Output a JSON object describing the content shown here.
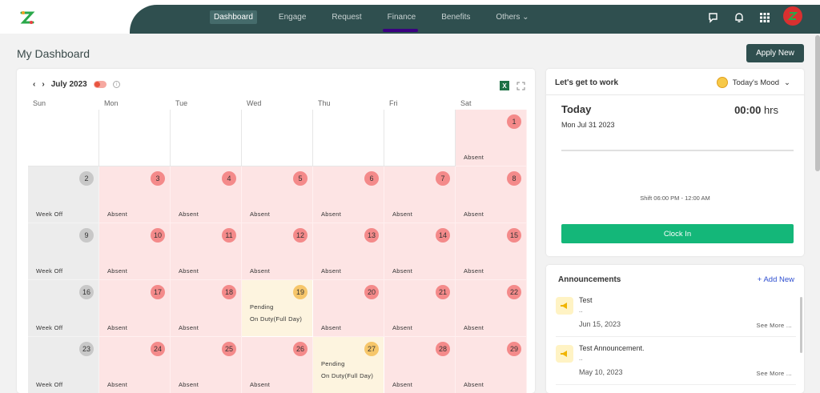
{
  "nav": {
    "items": [
      "Dashboard",
      "Engage",
      "Request",
      "Finance",
      "Benefits",
      "Others"
    ]
  },
  "page": {
    "title": "My Dashboard",
    "apply_label": "Apply New"
  },
  "calendar": {
    "month_label": "July 2023",
    "weekdays": [
      "Sun",
      "Mon",
      "Tue",
      "Wed",
      "Thu",
      "Fri",
      "Sat"
    ],
    "cells": [
      {
        "day": "",
        "kind": "empty",
        "status": ""
      },
      {
        "day": "",
        "kind": "empty",
        "status": ""
      },
      {
        "day": "",
        "kind": "empty",
        "status": ""
      },
      {
        "day": "",
        "kind": "empty",
        "status": ""
      },
      {
        "day": "",
        "kind": "empty",
        "status": ""
      },
      {
        "day": "",
        "kind": "empty",
        "status": ""
      },
      {
        "day": "1",
        "kind": "absent",
        "status": "Absent"
      },
      {
        "day": "2",
        "kind": "weekoff",
        "status": "Week Off"
      },
      {
        "day": "3",
        "kind": "absent",
        "status": "Absent"
      },
      {
        "day": "4",
        "kind": "absent",
        "status": "Absent"
      },
      {
        "day": "5",
        "kind": "absent",
        "status": "Absent"
      },
      {
        "day": "6",
        "kind": "absent",
        "status": "Absent"
      },
      {
        "day": "7",
        "kind": "absent",
        "status": "Absent"
      },
      {
        "day": "8",
        "kind": "absent",
        "status": "Absent"
      },
      {
        "day": "9",
        "kind": "weekoff",
        "status": "Week Off"
      },
      {
        "day": "10",
        "kind": "absent",
        "status": "Absent"
      },
      {
        "day": "11",
        "kind": "absent",
        "status": "Absent"
      },
      {
        "day": "12",
        "kind": "absent",
        "status": "Absent"
      },
      {
        "day": "13",
        "kind": "absent",
        "status": "Absent"
      },
      {
        "day": "14",
        "kind": "absent",
        "status": "Absent"
      },
      {
        "day": "15",
        "kind": "absent",
        "status": "Absent"
      },
      {
        "day": "16",
        "kind": "weekoff",
        "status": "Week Off"
      },
      {
        "day": "17",
        "kind": "absent",
        "status": "Absent"
      },
      {
        "day": "18",
        "kind": "absent",
        "status": "Absent"
      },
      {
        "day": "19",
        "kind": "pending",
        "status": "Pending",
        "detail": "On Duty(Full Day)"
      },
      {
        "day": "20",
        "kind": "absent",
        "status": "Absent"
      },
      {
        "day": "21",
        "kind": "absent",
        "status": "Absent"
      },
      {
        "day": "22",
        "kind": "absent",
        "status": "Absent"
      },
      {
        "day": "23",
        "kind": "weekoff",
        "status": "Week Off"
      },
      {
        "day": "24",
        "kind": "absent",
        "status": "Absent"
      },
      {
        "day": "25",
        "kind": "absent",
        "status": "Absent"
      },
      {
        "day": "26",
        "kind": "absent",
        "status": "Absent"
      },
      {
        "day": "27",
        "kind": "pending",
        "status": "Pending",
        "detail": "On Duty(Full Day)"
      },
      {
        "day": "28",
        "kind": "absent",
        "status": "Absent"
      },
      {
        "day": "29",
        "kind": "absent",
        "status": "Absent"
      }
    ]
  },
  "work": {
    "title": "Let's get to work",
    "mood_label": "Today's Mood",
    "today_label": "Today",
    "date": "Mon Jul 31 2023",
    "hours": "00:00",
    "hours_unit": "hrs",
    "shift": "Shift 06:00 PM - 12:00 AM",
    "clock_in_label": "Clock In"
  },
  "announcements": {
    "title": "Announcements",
    "add_label": "+ Add New",
    "items": [
      {
        "name": "Test",
        "body": "..",
        "date": "Jun 15, 2023",
        "more": "See More ..."
      },
      {
        "name": "Test Announcement.",
        "body": "..",
        "date": "May 10, 2023",
        "more": "See More ..."
      }
    ]
  },
  "colors": {
    "nav_bg": "#2f4f4f",
    "absent": "#fde4e4",
    "weekoff": "#ececec",
    "pending": "#fdf4df",
    "clock_in": "#14b779"
  }
}
